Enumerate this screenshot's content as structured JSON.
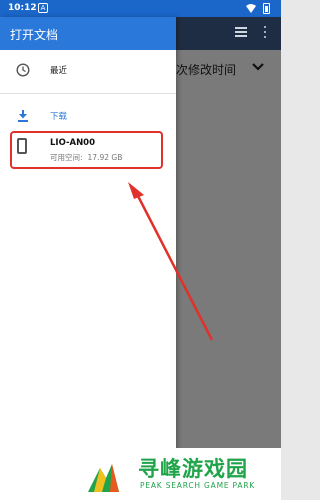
{
  "status_bar": {
    "time": "10:12",
    "badge": "A"
  },
  "background_app": {
    "sort_label": "次修改时间",
    "grid_icon": "grid-view-icon",
    "more_icon": "more-vert-icon",
    "chevron_icon": "chevron-down-icon"
  },
  "drawer": {
    "title": "打开文档",
    "items": [
      {
        "label": "最近",
        "icon": "clock-icon"
      },
      {
        "label": "下载",
        "icon": "download-icon"
      }
    ],
    "device": {
      "name": "LIO-AN00",
      "space_label": "可用空间:",
      "space_value": "17.92 GB",
      "icon": "phone-icon"
    }
  },
  "colors": {
    "status_bar": "#1b66c9",
    "drawer_header": "#2a78da",
    "highlight": "#e0312b",
    "watermark": "#20a44a"
  },
  "watermark": {
    "title": "寻峰游戏园",
    "subtitle": "PEAK SEARCH GAME PARK"
  }
}
